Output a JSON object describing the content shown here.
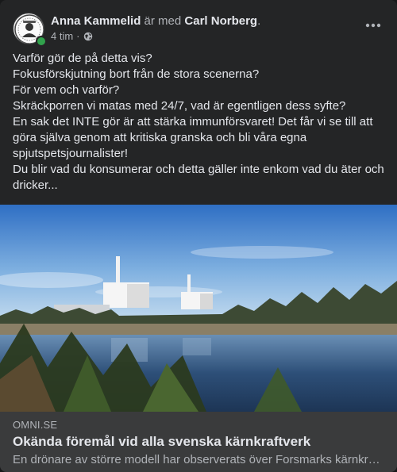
{
  "post": {
    "author": "Anna Kammelid",
    "with_text": "är med",
    "tagged": "Carl Norberg",
    "tagged_suffix": ".",
    "time": "4 tim",
    "separator": "·",
    "audience_icon": "globe-icon",
    "more_icon": "more-options-icon",
    "text_lines": [
      "Varför gör de på detta vis?",
      "Fokusförskjutning bort från de stora scenerna?",
      "För vem och varför?",
      "Skräckporren vi matas med 24/7, vad är egentligen dess syfte?",
      "En sak det INTE gör är att stärka immunförsvaret! Det får vi se till att göra själva genom att kritiska granska och bli våra egna spjutspetsjournalister!",
      "Du blir vad du konsumerar och detta gäller inte enkom vad du äter och dricker..."
    ]
  },
  "link_preview": {
    "domain": "OMNI.SE",
    "title": "Okända föremål vid alla svenska kärnkraftverk",
    "description": "En drönare av större modell har observerats över Forsmarks kärnkraftverk"
  },
  "colors": {
    "background": "#242526",
    "text_primary": "#e4e6eb",
    "text_secondary": "#b0b3b8",
    "online": "#31a24c",
    "link_box": "#3a3b3c"
  }
}
